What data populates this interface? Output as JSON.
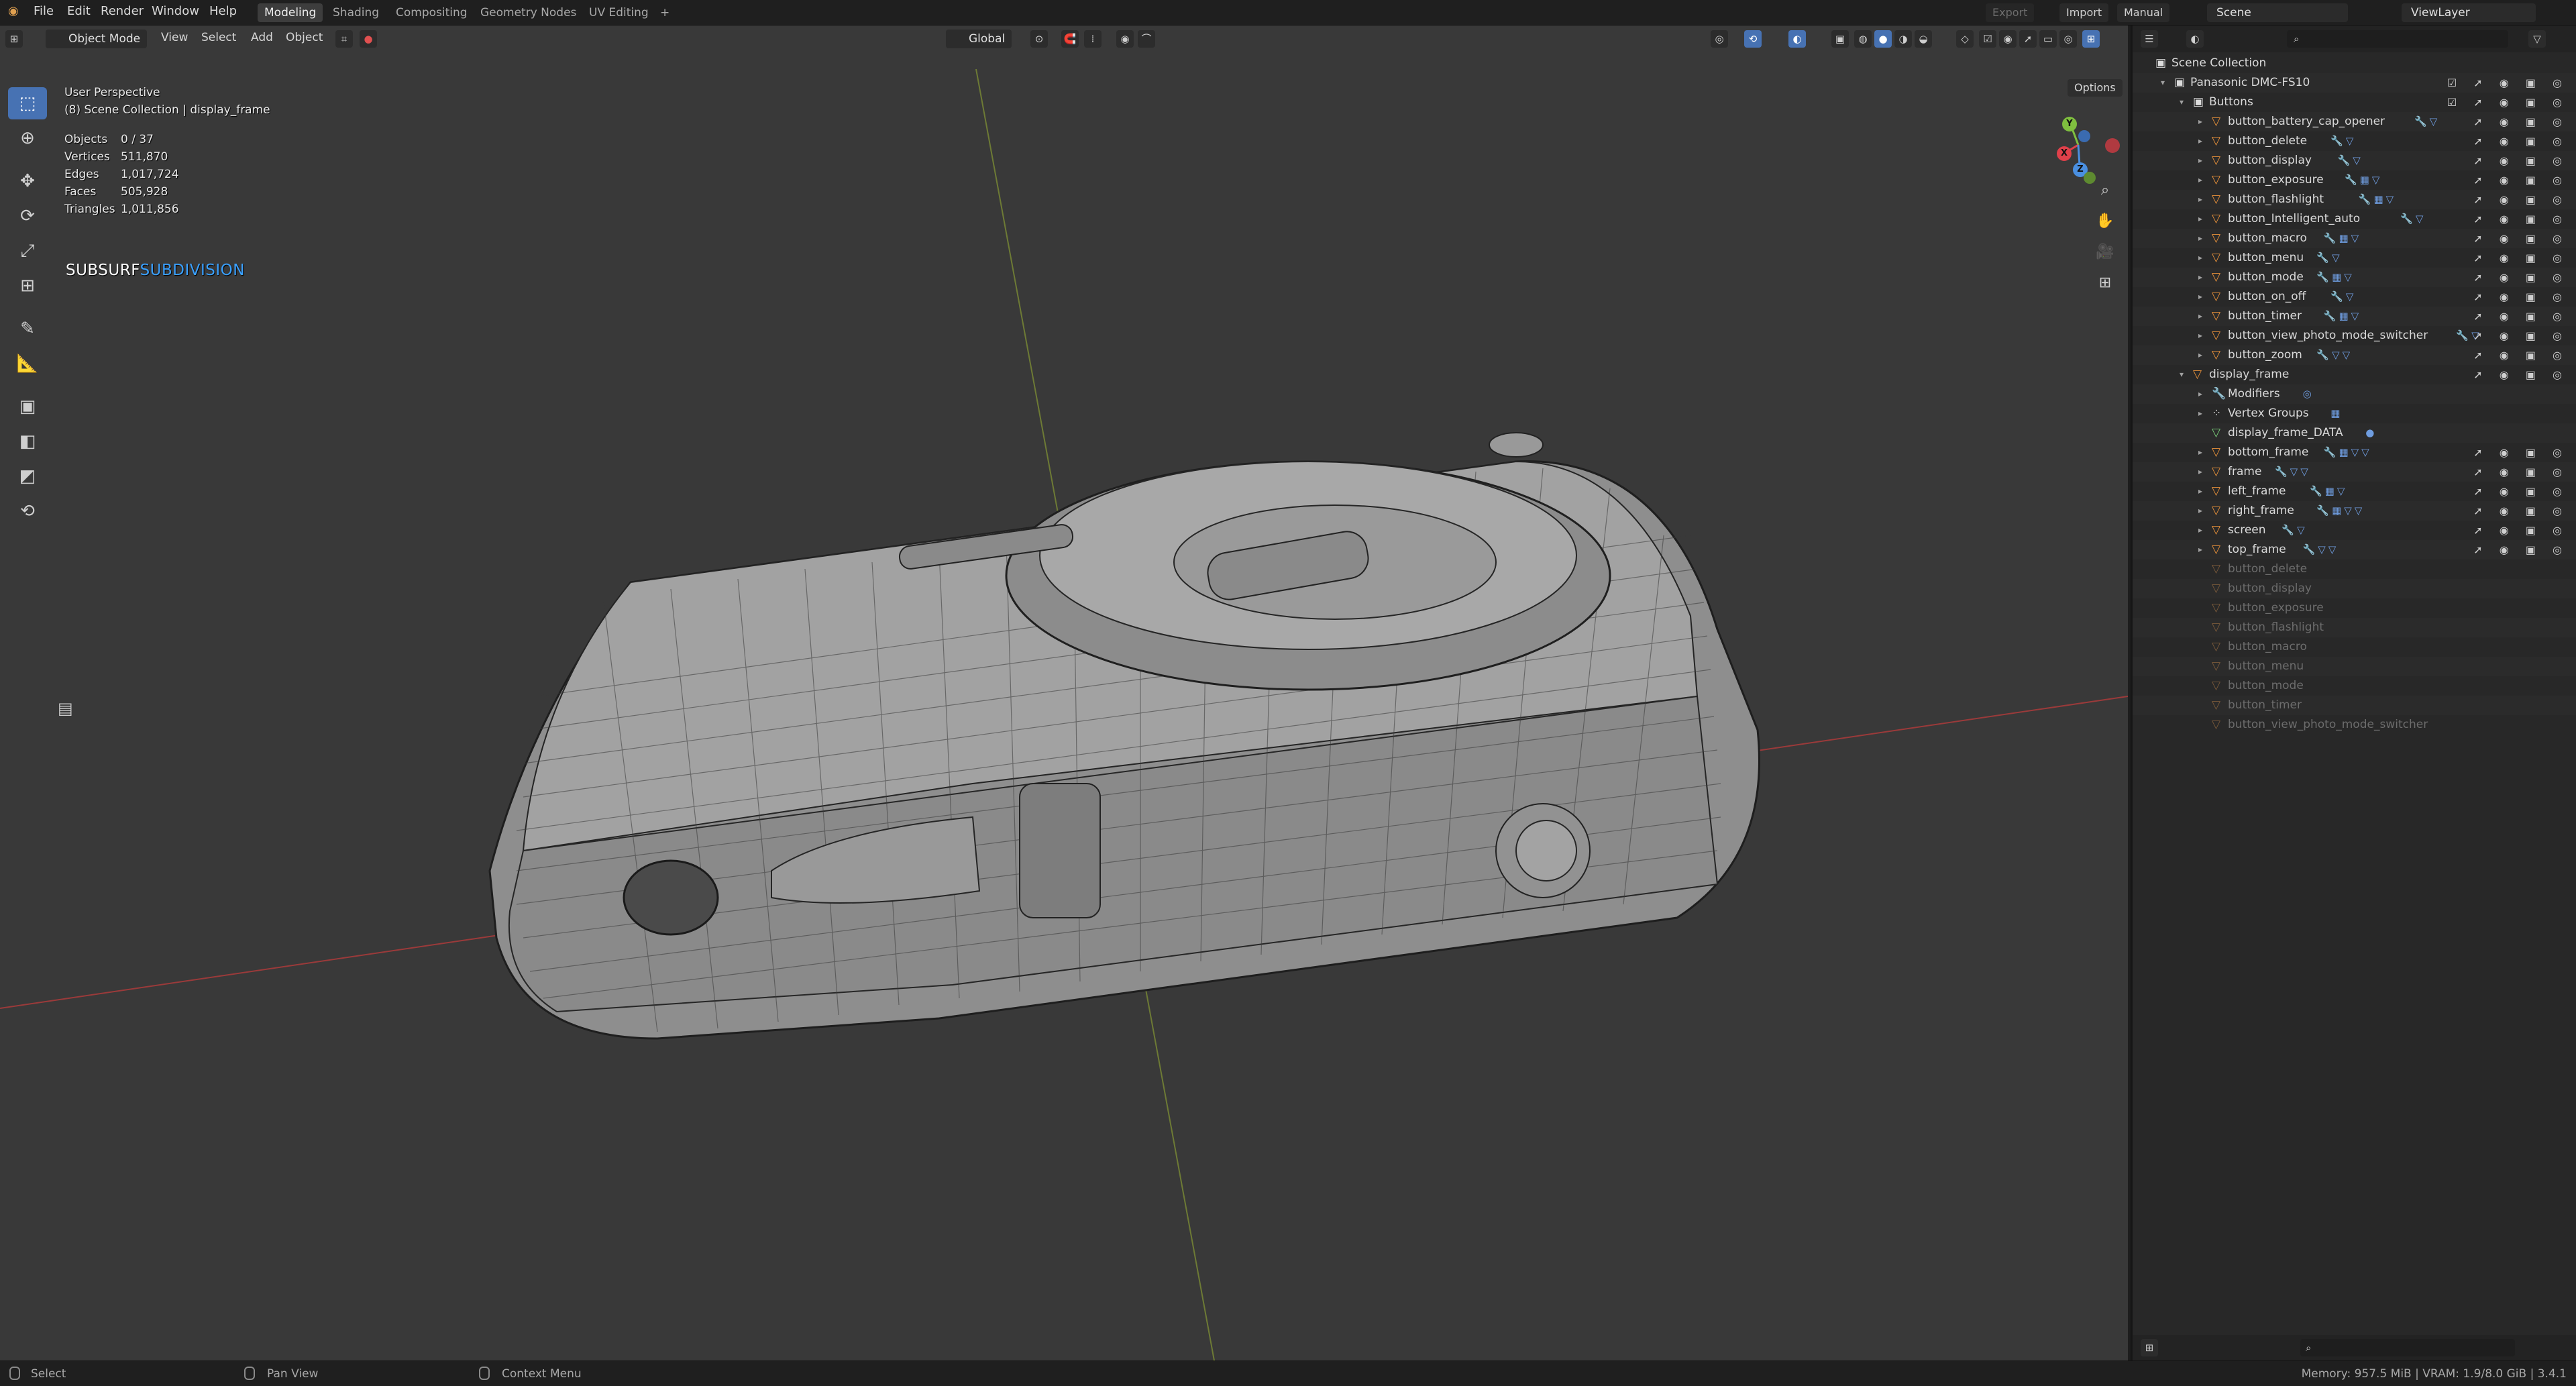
{
  "topbar": {
    "menus": [
      "File",
      "Edit",
      "Render",
      "Window",
      "Help"
    ],
    "workspaces": [
      "Modeling",
      "Shading",
      "Compositing",
      "Geometry Nodes",
      "UV Editing"
    ],
    "active_workspace": "Modeling",
    "add_tab": "+",
    "export_label": "Export",
    "import_label": "Import",
    "manual_label": "Manual",
    "scene_label": "Scene",
    "viewlayer_label": "ViewLayer"
  },
  "viewport_header": {
    "mode": "Object Mode",
    "menus": [
      "View",
      "Select",
      "Add",
      "Object"
    ],
    "orientation": "Global",
    "options_label": "Options"
  },
  "overlay": {
    "perspective": "User Perspective",
    "collection": "(8) Scene Collection | display_frame",
    "stats": [
      {
        "key": "Objects",
        "value": "0 / 37"
      },
      {
        "key": "Vertices",
        "value": "511,870"
      },
      {
        "key": "Edges",
        "value": "1,017,724"
      },
      {
        "key": "Faces",
        "value": "505,928"
      },
      {
        "key": "Triangles",
        "value": "1,011,856"
      }
    ],
    "subsurf_a": "SUBSURF",
    "subsurf_b": "SUBDIVISION"
  },
  "gizmo": {
    "x": "X",
    "y": "Y",
    "z": "Z"
  },
  "outliner": {
    "rows": [
      {
        "label": "Scene Collection",
        "indent": 0,
        "icon": "collection-icon",
        "arrow": "",
        "mods": "",
        "vis": "",
        "dim": false
      },
      {
        "label": "Panasonic DMC-FS10",
        "indent": 1,
        "icon": "collection-icon",
        "arrow": "▾",
        "mods": "",
        "vis": "☑ ➚ ◉ ▣ ◎",
        "dim": false
      },
      {
        "label": "Buttons",
        "indent": 2,
        "icon": "collection-icon",
        "arrow": "▾",
        "mods": "",
        "vis": "☑ ➚ ◉ ▣ ◎",
        "dim": false
      },
      {
        "label": "button_battery_cap_opener",
        "indent": 3,
        "icon": "mesh-icon",
        "arrow": "▸",
        "mods": "🔧▽",
        "vis": "➚ ◉ ▣ ◎",
        "dim": false
      },
      {
        "label": "button_delete",
        "indent": 3,
        "icon": "mesh-icon",
        "arrow": "▸",
        "mods": "🔧▽",
        "vis": "➚ ◉ ▣ ◎",
        "dim": false
      },
      {
        "label": "button_display",
        "indent": 3,
        "icon": "mesh-icon",
        "arrow": "▸",
        "mods": "🔧▽",
        "vis": "➚ ◉ ▣ ◎",
        "dim": false
      },
      {
        "label": "button_exposure",
        "indent": 3,
        "icon": "mesh-icon",
        "arrow": "▸",
        "mods": "🔧▦▽",
        "vis": "➚ ◉ ▣ ◎",
        "dim": false
      },
      {
        "label": "button_flashlight",
        "indent": 3,
        "icon": "mesh-icon",
        "arrow": "▸",
        "mods": "🔧▦▽",
        "vis": "➚ ◉ ▣ ◎",
        "dim": false
      },
      {
        "label": "button_Intelligent_auto",
        "indent": 3,
        "icon": "mesh-icon",
        "arrow": "▸",
        "mods": "🔧▽",
        "vis": "➚ ◉ ▣ ◎",
        "dim": false
      },
      {
        "label": "button_macro",
        "indent": 3,
        "icon": "mesh-icon",
        "arrow": "▸",
        "mods": "🔧▦▽",
        "vis": "➚ ◉ ▣ ◎",
        "dim": false
      },
      {
        "label": "button_menu",
        "indent": 3,
        "icon": "mesh-icon",
        "arrow": "▸",
        "mods": "🔧▽",
        "vis": "➚ ◉ ▣ ◎",
        "dim": false
      },
      {
        "label": "button_mode",
        "indent": 3,
        "icon": "mesh-icon",
        "arrow": "▸",
        "mods": "🔧▦▽",
        "vis": "➚ ◉ ▣ ◎",
        "dim": false
      },
      {
        "label": "button_on_off",
        "indent": 3,
        "icon": "mesh-icon",
        "arrow": "▸",
        "mods": "🔧▽",
        "vis": "➚ ◉ ▣ ◎",
        "dim": false
      },
      {
        "label": "button_timer",
        "indent": 3,
        "icon": "mesh-icon",
        "arrow": "▸",
        "mods": "🔧▦▽",
        "vis": "➚ ◉ ▣ ◎",
        "dim": false
      },
      {
        "label": "button_view_photo_mode_switcher",
        "indent": 3,
        "icon": "mesh-icon",
        "arrow": "▸",
        "mods": "🔧▽",
        "vis": "➚ ◉ ▣ ◎",
        "dim": false
      },
      {
        "label": "button_zoom",
        "indent": 3,
        "icon": "mesh-icon",
        "arrow": "▸",
        "mods": "🔧▽▽",
        "vis": "➚ ◉ ▣ ◎",
        "dim": false
      },
      {
        "label": "display_frame",
        "indent": 2,
        "icon": "mesh-icon",
        "arrow": "▾",
        "mods": "",
        "vis": "➚ ◉ ▣ ◎",
        "dim": false
      },
      {
        "label": "Modifiers",
        "indent": 3,
        "icon": "wrench-icon",
        "arrow": "▸",
        "mods": "◎",
        "vis": "",
        "dim": false
      },
      {
        "label": "Vertex Groups",
        "indent": 3,
        "icon": "vertex-group-icon",
        "arrow": "▸",
        "mods": "▦",
        "vis": "",
        "dim": false
      },
      {
        "label": "display_frame_DATA",
        "indent": 3,
        "icon": "mesh-data-icon",
        "arrow": "",
        "mods": "●",
        "vis": "",
        "dim": false
      },
      {
        "label": "bottom_frame",
        "indent": 3,
        "icon": "mesh-icon",
        "arrow": "▸",
        "mods": "🔧▦▽▽",
        "vis": "➚ ◉ ▣ ◎",
        "dim": false
      },
      {
        "label": "frame",
        "indent": 3,
        "icon": "mesh-icon",
        "arrow": "▸",
        "mods": "🔧▽▽",
        "vis": "➚ ◉ ▣ ◎",
        "dim": false
      },
      {
        "label": "left_frame",
        "indent": 3,
        "icon": "mesh-icon",
        "arrow": "▸",
        "mods": "🔧▦▽",
        "vis": "➚ ◉ ▣ ◎",
        "dim": false
      },
      {
        "label": "right_frame",
        "indent": 3,
        "icon": "mesh-icon",
        "arrow": "▸",
        "mods": "🔧▦▽▽",
        "vis": "➚ ◉ ▣ ◎",
        "dim": false
      },
      {
        "label": "screen",
        "indent": 3,
        "icon": "mesh-icon",
        "arrow": "▸",
        "mods": "🔧▽",
        "vis": "➚ ◉ ▣ ◎",
        "dim": false
      },
      {
        "label": "top_frame",
        "indent": 3,
        "icon": "mesh-icon",
        "arrow": "▸",
        "mods": "🔧▽▽",
        "vis": "➚ ◉ ▣ ◎",
        "dim": false
      },
      {
        "label": "button_delete",
        "indent": 3,
        "icon": "mesh-icon",
        "arrow": "",
        "mods": "",
        "vis": "",
        "dim": true
      },
      {
        "label": "button_display",
        "indent": 3,
        "icon": "mesh-icon",
        "arrow": "",
        "mods": "",
        "vis": "",
        "dim": true
      },
      {
        "label": "button_exposure",
        "indent": 3,
        "icon": "mesh-icon",
        "arrow": "",
        "mods": "",
        "vis": "",
        "dim": true
      },
      {
        "label": "button_flashlight",
        "indent": 3,
        "icon": "mesh-icon",
        "arrow": "",
        "mods": "",
        "vis": "",
        "dim": true
      },
      {
        "label": "button_macro",
        "indent": 3,
        "icon": "mesh-icon",
        "arrow": "",
        "mods": "",
        "vis": "",
        "dim": true
      },
      {
        "label": "button_menu",
        "indent": 3,
        "icon": "mesh-icon",
        "arrow": "",
        "mods": "",
        "vis": "",
        "dim": true
      },
      {
        "label": "button_mode",
        "indent": 3,
        "icon": "mesh-icon",
        "arrow": "",
        "mods": "",
        "vis": "",
        "dim": true
      },
      {
        "label": "button_timer",
        "indent": 3,
        "icon": "mesh-icon",
        "arrow": "",
        "mods": "",
        "vis": "",
        "dim": true
      },
      {
        "label": "button_view_photo_mode_switcher",
        "indent": 3,
        "icon": "mesh-icon",
        "arrow": "",
        "mods": "",
        "vis": "",
        "dim": true
      }
    ]
  },
  "statusbar": {
    "select": "Select",
    "pan_view": "Pan View",
    "context_menu": "Context Menu",
    "memory": "Memory: 957.5 MiB | VRAM: 1.9/8.0 GiB | 3.4.1"
  },
  "colors": {
    "accent": "#4772b3",
    "subsurf_blue": "#3aa0ff",
    "mesh_orange": "#e8913a",
    "axis_x": "#e0404a",
    "axis_y": "#7fbf3f",
    "axis_z": "#4a8fe0"
  }
}
